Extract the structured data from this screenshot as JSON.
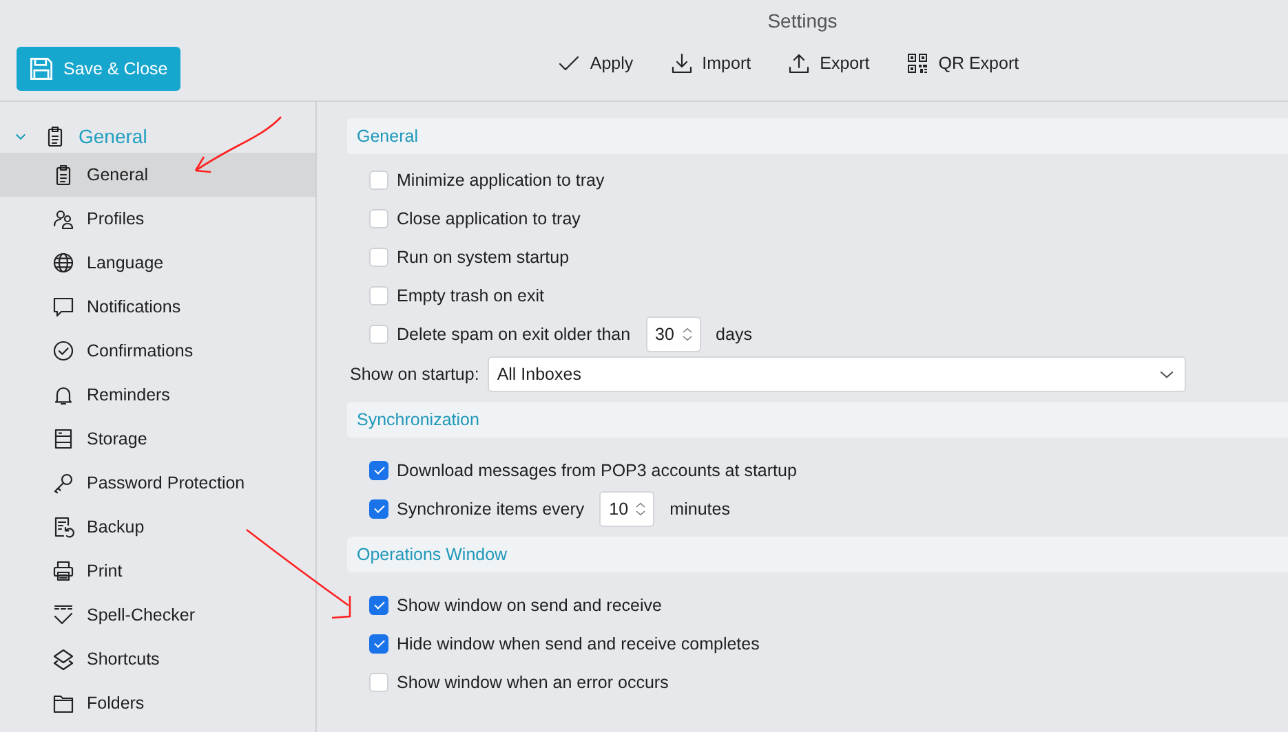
{
  "window": {
    "title": "Settings"
  },
  "save_button": {
    "label": "Save & Close"
  },
  "toolbar": [
    {
      "label": "Apply"
    },
    {
      "label": "Import"
    },
    {
      "label": "Export"
    },
    {
      "label": "QR Export"
    }
  ],
  "sidebar": {
    "group": {
      "label": "General",
      "expanded": true,
      "children": [
        {
          "label": "General",
          "selected": true
        },
        {
          "label": "Profiles",
          "selected": false
        },
        {
          "label": "Language",
          "selected": false
        },
        {
          "label": "Notifications",
          "selected": false
        },
        {
          "label": "Confirmations",
          "selected": false
        },
        {
          "label": "Reminders",
          "selected": false
        },
        {
          "label": "Storage",
          "selected": false
        },
        {
          "label": "Password Protection",
          "selected": false
        },
        {
          "label": "Backup",
          "selected": false
        },
        {
          "label": "Print",
          "selected": false
        },
        {
          "label": "Spell-Checker",
          "selected": false
        },
        {
          "label": "Shortcuts",
          "selected": false
        },
        {
          "label": "Folders",
          "selected": false
        }
      ]
    }
  },
  "sections": [
    {
      "title": "General",
      "items": [
        {
          "kind": "checkbox",
          "label": "Minimize application to tray",
          "checked": false
        },
        {
          "kind": "checkbox",
          "label": "Close application to tray",
          "checked": false
        },
        {
          "kind": "checkbox",
          "label": "Run on system startup",
          "checked": false
        },
        {
          "kind": "checkbox",
          "label": "Empty trash on exit",
          "checked": false
        },
        {
          "kind": "checkbox",
          "label": "Delete spam on exit older than",
          "checked": false,
          "spin_value": "30",
          "suffix": "days"
        },
        {
          "kind": "select",
          "label": "Show on startup:",
          "value": "All Inboxes"
        }
      ]
    },
    {
      "title": "Synchronization",
      "items": [
        {
          "kind": "checkbox",
          "label": "Download messages from POP3 accounts at startup",
          "checked": true
        },
        {
          "kind": "checkbox",
          "label": "Synchronize items every",
          "checked": true,
          "spin_value": "10",
          "suffix": "minutes"
        }
      ]
    },
    {
      "title": "Operations Window",
      "items": [
        {
          "kind": "checkbox",
          "label": "Show window on send and receive",
          "checked": true
        },
        {
          "kind": "checkbox",
          "label": "Hide window when send and receive completes",
          "checked": true
        },
        {
          "kind": "checkbox",
          "label": "Show window when an error occurs",
          "checked": false
        }
      ]
    }
  ]
}
